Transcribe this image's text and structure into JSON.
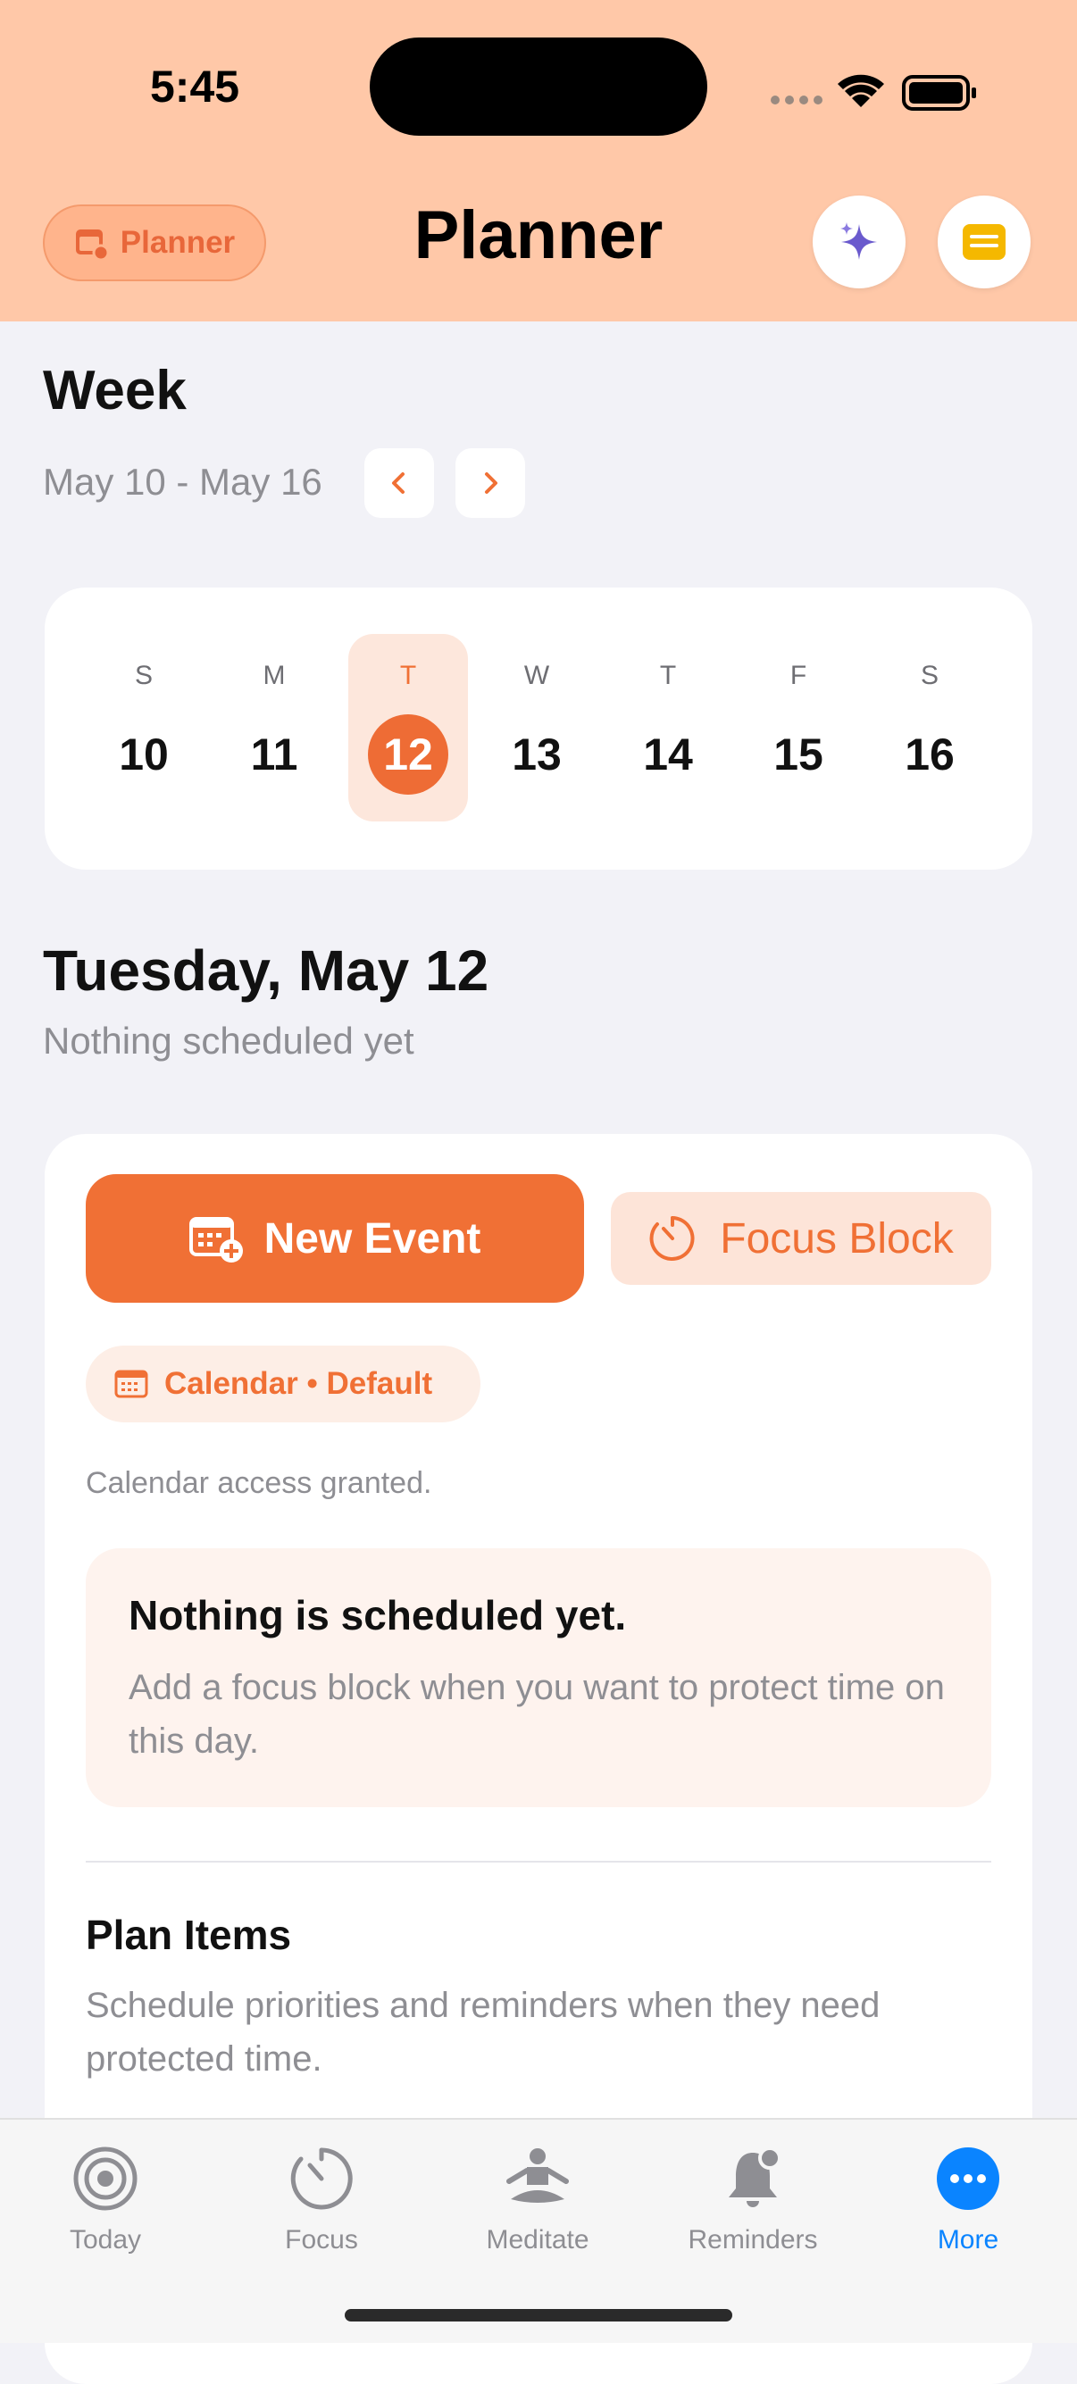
{
  "status_bar": {
    "time": "5:45"
  },
  "header": {
    "pill_label": "Planner",
    "title": "Planner",
    "sparkle_icon": "sparkle-icon",
    "notes_icon": "notes-icon"
  },
  "week": {
    "title": "Week",
    "range": "May 10 - May 16",
    "days": [
      {
        "letter": "S",
        "num": "10"
      },
      {
        "letter": "M",
        "num": "11"
      },
      {
        "letter": "T",
        "num": "12",
        "selected": true
      },
      {
        "letter": "W",
        "num": "13"
      },
      {
        "letter": "T",
        "num": "14"
      },
      {
        "letter": "F",
        "num": "15"
      },
      {
        "letter": "S",
        "num": "16"
      }
    ]
  },
  "day": {
    "heading": "Tuesday, May 12",
    "subtitle": "Nothing scheduled yet"
  },
  "actions": {
    "new_event": "New Event",
    "focus_block": "Focus Block",
    "calendar_chip": "Calendar • Default",
    "access_text": "Calendar access granted."
  },
  "empty_state": {
    "title": "Nothing is scheduled yet.",
    "description": "Add a focus block when you want to protect time on this day."
  },
  "plan_items": {
    "title": "Plan Items",
    "description": "Schedule priorities and reminders when they need protected time."
  },
  "tabs": [
    {
      "label": "Today",
      "icon": "target-icon"
    },
    {
      "label": "Focus",
      "icon": "timer-icon"
    },
    {
      "label": "Meditate",
      "icon": "meditate-icon"
    },
    {
      "label": "Reminders",
      "icon": "bell-icon"
    },
    {
      "label": "More",
      "icon": "more-icon",
      "active": true
    }
  ],
  "colors": {
    "accent": "#f07035",
    "header_bg": "#ffc8a8",
    "tab_active": "#0a84ff"
  }
}
